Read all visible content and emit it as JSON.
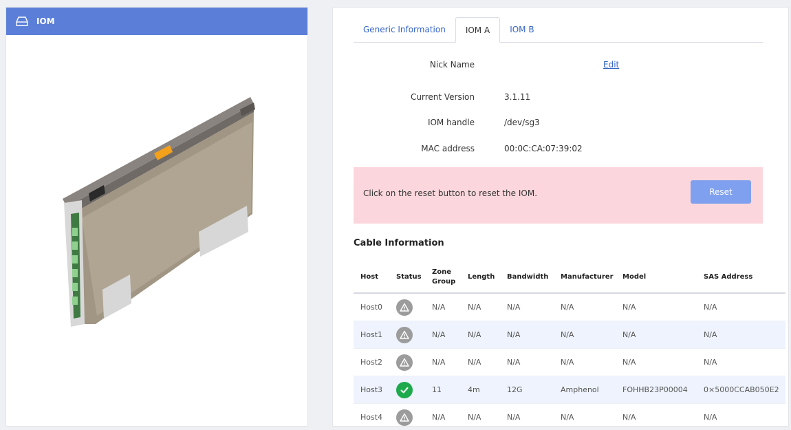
{
  "left_panel": {
    "title": "IOM",
    "device_label": "PAGE"
  },
  "tabs": [
    {
      "label": "Generic Information",
      "active": false
    },
    {
      "label": "IOM A",
      "active": true
    },
    {
      "label": "IOM B",
      "active": false
    }
  ],
  "details": {
    "nick_name_label": "Nick Name",
    "nick_name_action": "Edit",
    "current_version_label": "Current Version",
    "current_version": "3.1.11",
    "iom_handle_label": "IOM handle",
    "iom_handle": "/dev/sg3",
    "mac_address_label": "MAC address",
    "mac_address": "00:0C:CA:07:39:02"
  },
  "alert": {
    "message": "Click on the reset button to reset the IOM.",
    "button_label": "Reset",
    "background": "#fbd7dd",
    "button_color": "#7fa0ee"
  },
  "cable_section": {
    "title": "Cable Information",
    "headers": [
      "Host",
      "Status",
      "Zone Group",
      "Length",
      "Bandwidth",
      "Manufacturer",
      "Model",
      "SAS Address"
    ],
    "rows": [
      {
        "host": "Host0",
        "status": "unknown",
        "zone_group": "N/A",
        "length": "N/A",
        "bandwidth": "N/A",
        "manufacturer": "N/A",
        "model": "N/A",
        "sas_address": "N/A"
      },
      {
        "host": "Host1",
        "status": "unknown",
        "zone_group": "N/A",
        "length": "N/A",
        "bandwidth": "N/A",
        "manufacturer": "N/A",
        "model": "N/A",
        "sas_address": "N/A"
      },
      {
        "host": "Host2",
        "status": "unknown",
        "zone_group": "N/A",
        "length": "N/A",
        "bandwidth": "N/A",
        "manufacturer": "N/A",
        "model": "N/A",
        "sas_address": "N/A"
      },
      {
        "host": "Host3",
        "status": "ok",
        "zone_group": "11",
        "length": "4m",
        "bandwidth": "12G",
        "manufacturer": "Amphenol",
        "model": "FOHHB23P00004",
        "sas_address": "0×5000CCAB050E2"
      },
      {
        "host": "Host4",
        "status": "unknown",
        "zone_group": "N/A",
        "length": "N/A",
        "bandwidth": "N/A",
        "manufacturer": "N/A",
        "model": "N/A",
        "sas_address": "N/A"
      }
    ]
  },
  "colors": {
    "accent": "#5b7fd8",
    "link": "#3564c6",
    "status_ok": "#1eaa4c",
    "status_unknown": "#9c9c9c"
  }
}
